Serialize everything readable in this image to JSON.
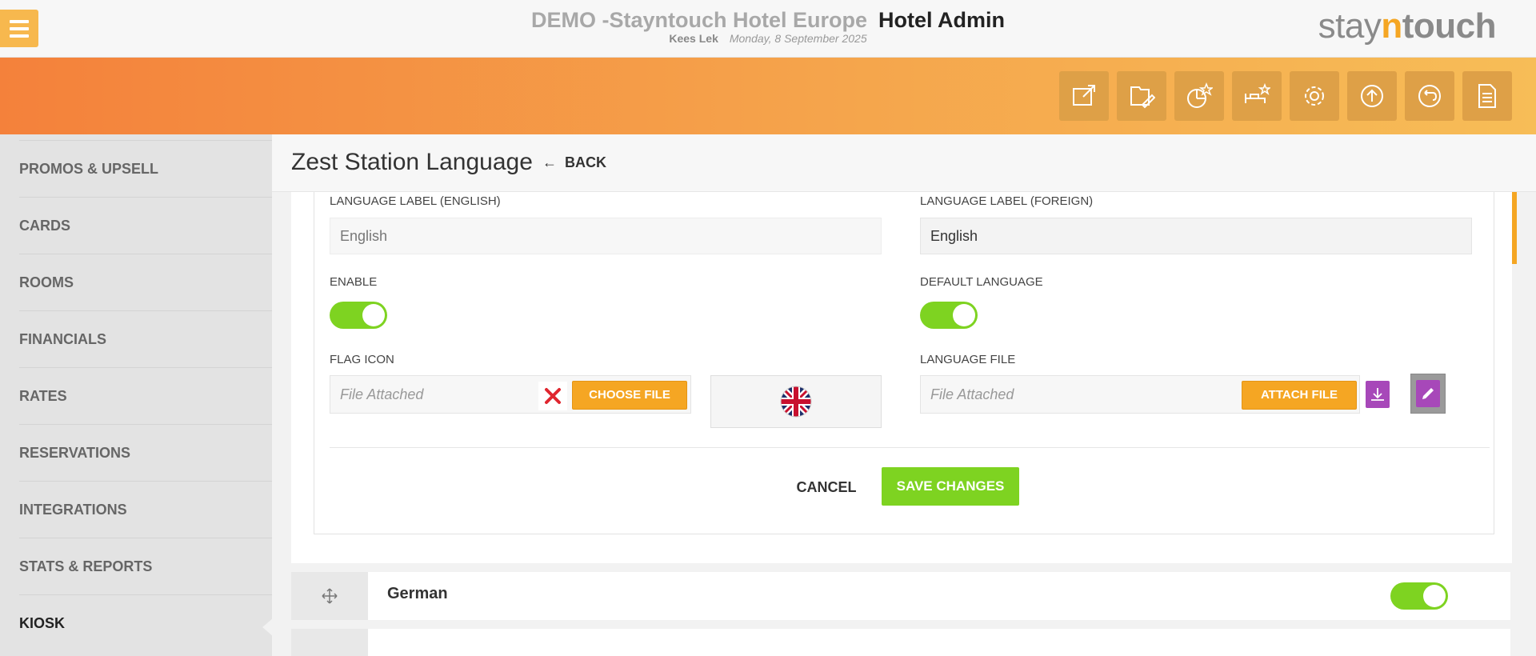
{
  "header": {
    "hotel_name": "DEMO -Stayntouch Hotel Europe",
    "app_title": "Hotel Admin",
    "user": "Kees Lek",
    "date": "Monday, 8 September 2025",
    "logo_a": "stay",
    "logo_n": "n",
    "logo_b": "touch"
  },
  "toolbar": {
    "icons": [
      "external-link-icon",
      "edit-folder-icon",
      "chart-star-icon",
      "bed-star-icon",
      "gear-icon",
      "upload-icon",
      "return-icon",
      "document-icon"
    ]
  },
  "sidebar": {
    "items": [
      {
        "label": "PROMOS & UPSELL"
      },
      {
        "label": "CARDS"
      },
      {
        "label": "ROOMS"
      },
      {
        "label": "FINANCIALS"
      },
      {
        "label": "RATES"
      },
      {
        "label": "RESERVATIONS"
      },
      {
        "label": "INTEGRATIONS"
      },
      {
        "label": "STATS & REPORTS"
      },
      {
        "label": "KIOSK"
      }
    ],
    "active": "KIOSK"
  },
  "page": {
    "title": "Zest Station Language",
    "back_arrow": "←",
    "back_label": "BACK"
  },
  "form": {
    "label_english": "LANGUAGE LABEL (ENGLISH)",
    "value_english": "English",
    "label_foreign": "LANGUAGE LABEL (FOREIGN)",
    "value_foreign": "English",
    "enable_label": "ENABLE",
    "enable_on": true,
    "default_label": "DEFAULT LANGUAGE",
    "default_on": true,
    "flag_label": "FLAG ICON",
    "flag_file_placeholder": "File Attached",
    "choose_file": "CHOOSE FILE",
    "language_file_label": "LANGUAGE FILE",
    "language_file_placeholder": "File Attached",
    "attach_file": "ATTACH FILE",
    "cancel": "CANCEL",
    "save": "SAVE CHANGES"
  },
  "languages": [
    {
      "name": "German",
      "enabled": true
    }
  ],
  "colors": {
    "accent_orange": "#f5a623",
    "toggle_green": "#7ed321",
    "purple": "#a748b9"
  }
}
